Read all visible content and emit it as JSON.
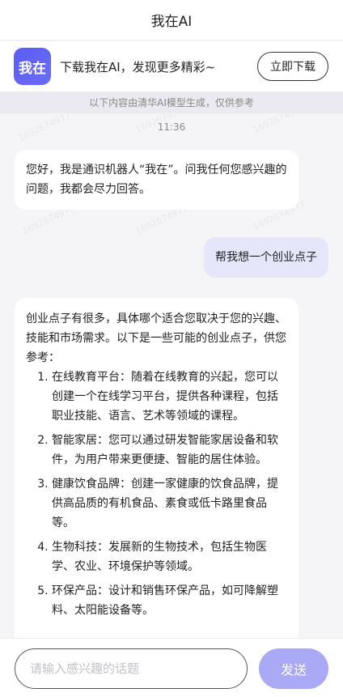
{
  "header": {
    "title": "我在AI"
  },
  "banner": {
    "logo_text": "我在",
    "text": "下载我在AI，发现更多精彩~",
    "download_label": "立即下载"
  },
  "disclaimer": "以下内容由清华AI模型生成，仅供参考",
  "watermark_text": "1692674977",
  "chat": {
    "timestamp": "11:36",
    "greeting": "您好，我是通识机器人“我在”。问我任何您感兴趣的问题，我都会尽力回答。",
    "user_message": "帮我想一个创业点子",
    "reply": {
      "intro": "创业点子有很多，具体哪个适合您取决于您的兴趣、技能和市场需求。以下是一些可能的创业点子，供您参考：",
      "items": [
        "在线教育平台：随着在线教育的兴起，您可以创建一个在线学习平台，提供各种课程，包括职业技能、语言、艺术等领域的课程。",
        "智能家居：您可以通过研发智能家居设备和软件，为用户带来更便捷、智能的居住体验。",
        "健康饮食品牌：创建一家健康的饮食品牌，提供高品质的有机食品、素食或低卡路里食品等。",
        "生物科技：发展新的生物技术，包括生物医学、农业、环境保护等领域。",
        "环保产品：设计和销售环保产品，如可降解塑料、太阳能设备等。"
      ]
    }
  },
  "input": {
    "placeholder": "请输入感兴趣的话题",
    "send_label": "发送"
  }
}
